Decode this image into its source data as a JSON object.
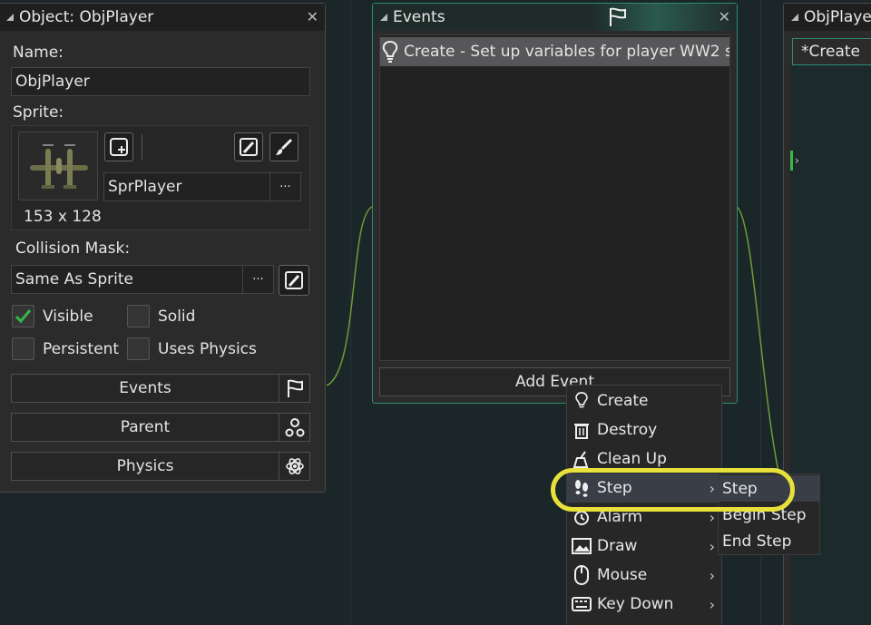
{
  "object_panel": {
    "title": "Object: ObjPlayer",
    "close": "✕",
    "name_label": "Name:",
    "name_value": "ObjPlayer",
    "sprite_label": "Sprite:",
    "sprite_name": "SprPlayer",
    "sprite_more": "···",
    "sprite_size": "153 x 128",
    "collision_label": "Collision Mask:",
    "collision_value": "Same As Sprite",
    "collision_more": "···",
    "checkboxes": {
      "visible": "Visible",
      "solid": "Solid",
      "persistent": "Persistent",
      "uses_physics": "Uses Physics"
    },
    "visible_checked": true,
    "buttons": {
      "events": "Events",
      "parent": "Parent",
      "physics": "Physics"
    }
  },
  "events_panel": {
    "title": "Events",
    "close": "✕",
    "event_item": "Create - Set up variables for player WW2 s",
    "add_event": "Add Event"
  },
  "code_panel": {
    "title": "ObjPlaye",
    "tab": "*Create"
  },
  "context_menu": {
    "items": [
      {
        "label": "Create",
        "icon": "lightbulb-icon"
      },
      {
        "label": "Destroy",
        "icon": "trash-icon"
      },
      {
        "label": "Clean Up",
        "icon": "broom-icon"
      },
      {
        "label": "Step",
        "icon": "footsteps-icon"
      },
      {
        "label": "Alarm",
        "icon": "alarm-clock-icon"
      },
      {
        "label": "Draw",
        "icon": "picture-icon"
      },
      {
        "label": "Mouse",
        "icon": "mouse-icon"
      },
      {
        "label": "Key Down",
        "icon": "keyboard-icon"
      }
    ],
    "arrow": "›"
  },
  "step_submenu": {
    "items": [
      "Step",
      "Begin Step",
      "End Step"
    ]
  },
  "colors": {
    "events_accent": "#2f8a72",
    "check_green": "#35b84a",
    "highlight_ring": "#e8e13a",
    "menu_hover": "#3a3f47"
  }
}
